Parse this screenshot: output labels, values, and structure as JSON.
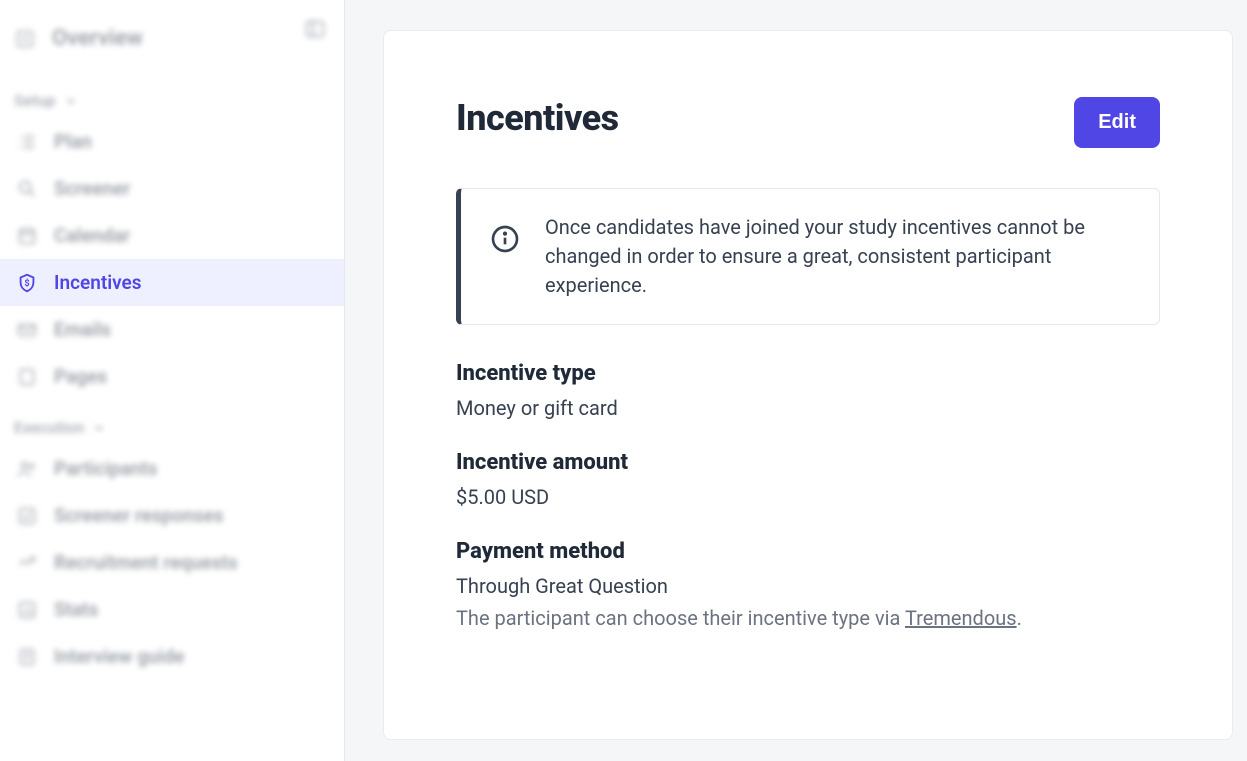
{
  "sidebar": {
    "overview": "Overview",
    "setup_heading": "Setup",
    "plan": "Plan",
    "screener": "Screener",
    "calendar": "Calendar",
    "incentives": "Incentives",
    "emails": "Emails",
    "pages": "Pages",
    "execution_heading": "Execution",
    "participants": "Participants",
    "screener_responses": "Screener responses",
    "recruitment_requests": "Recruitment requests",
    "stats": "Stats",
    "interview_guide": "Interview guide"
  },
  "main": {
    "title": "Incentives",
    "edit_label": "Edit",
    "info_text": "Once candidates have joined your study incentives cannot be changed in order to ensure a great, consistent participant experience.",
    "fields": {
      "type_label": "Incentive type",
      "type_value": "Money or gift card",
      "amount_label": "Incentive amount",
      "amount_value": "$5.00 USD",
      "method_label": "Payment method",
      "method_value": "Through Great Question",
      "method_hint_prefix": "The participant can choose their incentive type via ",
      "method_hint_link": "Tremendous",
      "method_hint_suffix": "."
    }
  }
}
